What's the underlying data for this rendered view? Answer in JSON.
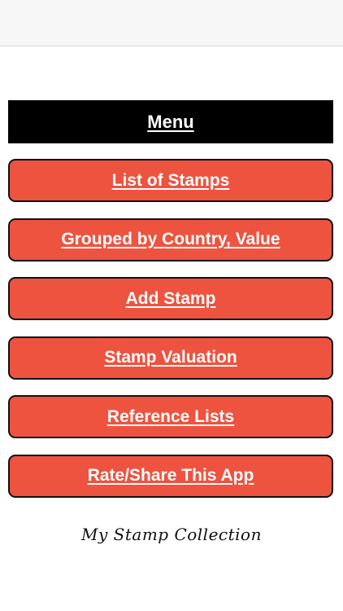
{
  "menu": {
    "header": "Menu",
    "items": [
      {
        "label": "List of Stamps"
      },
      {
        "label": "Grouped by Country, Value"
      },
      {
        "label": "Add Stamp"
      },
      {
        "label": "Stamp Valuation"
      },
      {
        "label": "Reference Lists"
      },
      {
        "label": "Rate/Share This App"
      }
    ]
  },
  "footer": {
    "title": "My Stamp Collection"
  },
  "colors": {
    "button": "#ee5340",
    "header": "#000000",
    "text_light": "#ffffff"
  }
}
